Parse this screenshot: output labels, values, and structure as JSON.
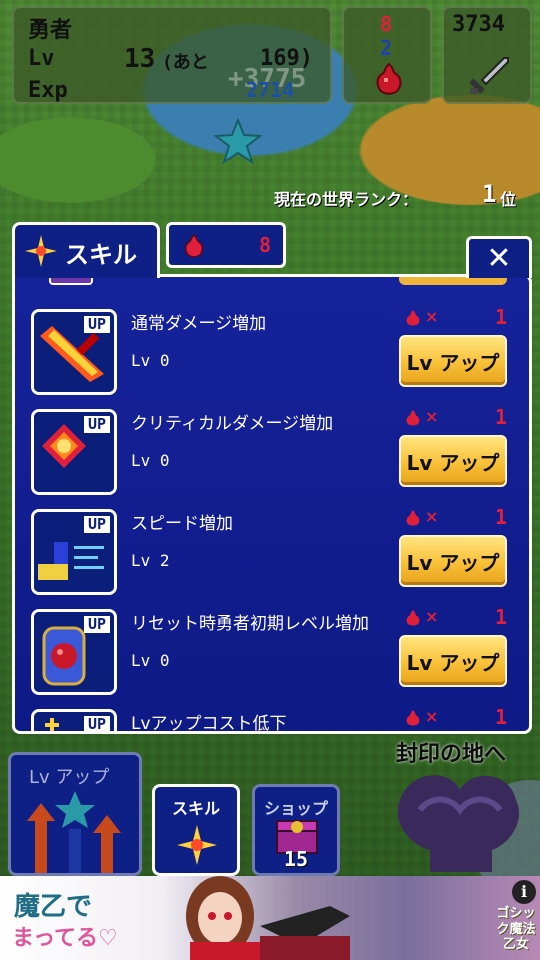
{
  "status": {
    "hero_name": "勇者",
    "lv_label": "Lv",
    "lv_value": "13",
    "ato_label": "(あと",
    "ato_value": "169)",
    "exp_label": "Exp",
    "exp_value": "2714",
    "floating_exp": "+3775",
    "red_gems": "8",
    "blue_gems": "2",
    "gold": "3734"
  },
  "rank": {
    "label": "現在の世界ランク：",
    "value": "1",
    "unit": "位"
  },
  "skill_panel": {
    "tab_label": "スキル",
    "gem_count": "8",
    "close_label": "✕",
    "skills": [
      {
        "name": "通常ダメージ増加",
        "level": "Lv 0",
        "cost": "1",
        "button": "Lv アップ",
        "up_tag": "UP",
        "icon": "flaming-sword-icon"
      },
      {
        "name": "クリティカルダメージ増加",
        "level": "Lv 0",
        "cost": "1",
        "button": "Lv アップ",
        "up_tag": "UP",
        "icon": "critical-burst-icon"
      },
      {
        "name": "スピード増加",
        "level": "Lv 2",
        "cost": "1",
        "button": "Lv アップ",
        "up_tag": "UP",
        "icon": "speed-boot-icon"
      },
      {
        "name": "リセット時勇者初期レベル増加",
        "level": "Lv 0",
        "cost": "1",
        "button": "Lv アップ",
        "up_tag": "UP",
        "icon": "gem-amulet-icon"
      },
      {
        "name": "Lvアップコスト低下",
        "cost": "1",
        "up_tag": "UP",
        "icon": "cost-down-icon"
      }
    ]
  },
  "bottom": {
    "seal_label": "封印の地へ",
    "lvup_label": "Lv アップ",
    "skill_button": "スキル",
    "shop_button": "ショップ",
    "shop_count": "15"
  },
  "ad": {
    "line1": "魔乙で",
    "line2": "まってる♡",
    "info": "i",
    "logo": "ゴシック魔法乙女"
  },
  "colors": {
    "panel_bg": "#0e1f86",
    "button_gold": "#f9c037",
    "gem_red": "#e0203a",
    "gem_blue": "#1d3fb0"
  }
}
